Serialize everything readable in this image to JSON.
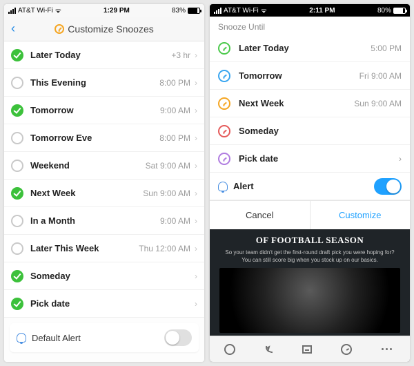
{
  "left": {
    "status": {
      "carrier": "AT&T Wi-Fi",
      "time": "1:29 PM",
      "battery_pct": "83%",
      "battery_fill": 83
    },
    "header": {
      "title": "Customize Snoozes"
    },
    "items": [
      {
        "label": "Later Today",
        "value": "+3 hr",
        "checked": true
      },
      {
        "label": "This Evening",
        "value": "8:00 PM",
        "checked": false
      },
      {
        "label": "Tomorrow",
        "value": "9:00 AM",
        "checked": true
      },
      {
        "label": "Tomorrow Eve",
        "value": "8:00 PM",
        "checked": false
      },
      {
        "label": "Weekend",
        "value": "Sat 9:00 AM",
        "checked": false
      },
      {
        "label": "Next Week",
        "value": "Sun 9:00 AM",
        "checked": true
      },
      {
        "label": "In a Month",
        "value": "9:00 AM",
        "checked": false
      },
      {
        "label": "Later This Week",
        "value": "Thu 12:00 AM",
        "checked": false
      },
      {
        "label": "Someday",
        "value": "",
        "checked": true
      },
      {
        "label": "Pick date",
        "value": "",
        "checked": true
      }
    ],
    "alert": {
      "label": "Default Alert",
      "on": false
    }
  },
  "right": {
    "status": {
      "carrier": "AT&T Wi-Fi",
      "time": "2:11 PM",
      "battery_pct": "80%",
      "battery_fill": 80
    },
    "sheet": {
      "title": "Snooze Until",
      "items": [
        {
          "label": "Later Today",
          "sub": "5:00 PM",
          "color": "c-green"
        },
        {
          "label": "Tomorrow",
          "sub": "Fri 9:00 AM",
          "color": "c-blue"
        },
        {
          "label": "Next Week",
          "sub": "Sun 9:00 AM",
          "color": "c-orange"
        },
        {
          "label": "Someday",
          "sub": "",
          "color": "c-red"
        },
        {
          "label": "Pick date",
          "sub": "›",
          "color": "c-purple"
        }
      ],
      "alert": {
        "label": "Alert",
        "on": true
      },
      "cancel": "Cancel",
      "customize": "Customize"
    },
    "promo": {
      "heading": "OF FOOTBALL SEASON",
      "body": "So your team didn't get the first-round draft pick you were hoping for? You can still score big when you stock up on our basics."
    }
  }
}
